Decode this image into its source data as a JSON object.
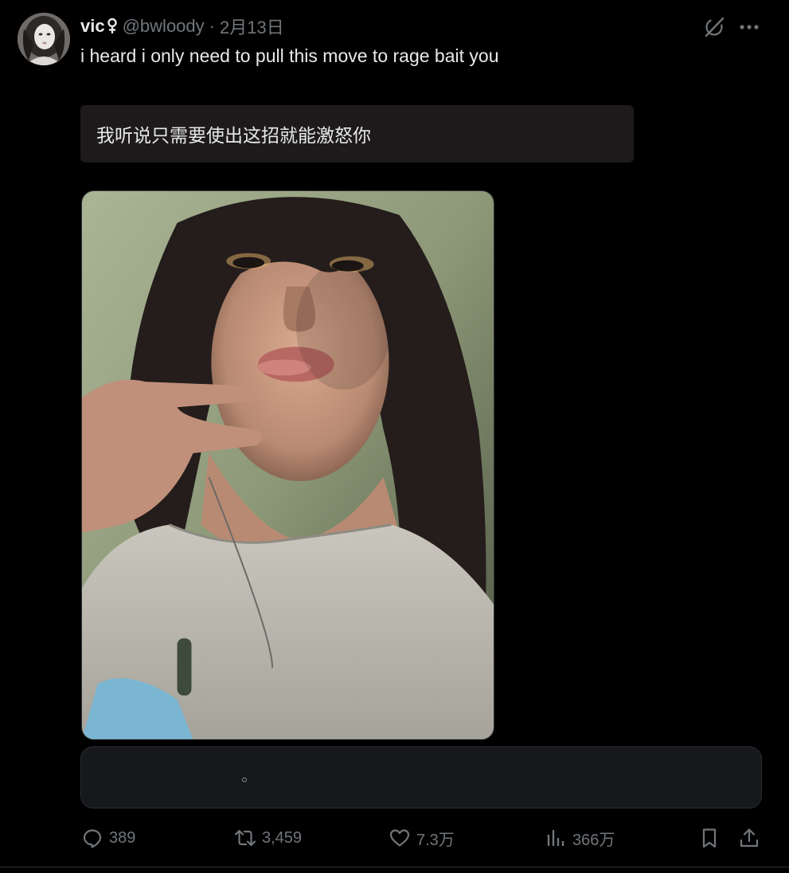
{
  "author": {
    "display_name": "vic",
    "badge_icon": "female-sign-icon",
    "handle": "@bwloody",
    "separator": "·",
    "timestamp": "2月13日"
  },
  "header_actions": {
    "grok_icon": "grok-icon",
    "more_icon": "more-horizontal-icon"
  },
  "tweet": {
    "text": "i heard i only need to pull this move to rage bait you",
    "translation": "我听说只需要使出这招就能激怒你"
  },
  "media": {
    "type": "photo"
  },
  "actions": {
    "reply_count": "389",
    "retweet_count": "3,459",
    "like_count": "7.3万",
    "view_count": "366万"
  },
  "colors": {
    "background": "#000000",
    "text_primary": "#e7e9ea",
    "text_secondary": "#71767b",
    "translation_bg": "#1e1a1b",
    "card_bg": "#16181c"
  }
}
